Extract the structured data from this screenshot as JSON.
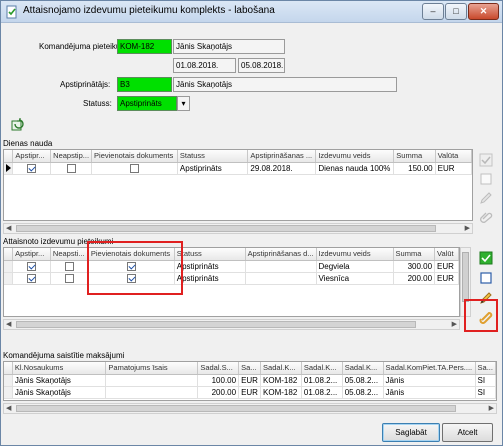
{
  "window": {
    "title": "Attaisnojamo izdevumu pieteikumu komplekts - labošana"
  },
  "form": {
    "komandejuma_label": "Komandējuma pieteikums:",
    "komandejuma_code": "KOM-182",
    "komandejuma_name": "Jānis Skaņotājs",
    "date_from": "01.08.2018.",
    "date_to": "05.08.2018.",
    "apstiprinatajs_label": "Apstiprinātājs:",
    "apstiprinatajs_code": "B3",
    "apstiprinatajs_name": "Jānis Skaņotājs",
    "statuss_label": "Statuss:",
    "statuss_value": "Apstiprināts"
  },
  "dienas_nauda": {
    "title": "Dienas nauda",
    "columns": [
      "Apstipr...",
      "Neapstip...",
      "Pievienotais dokuments",
      "Statuss",
      "Apstiprināšanas ...",
      "Izdevumu veids",
      "Summa",
      "Valūta"
    ],
    "rows": [
      {
        "apstiprinats": true,
        "neapstiprinats": false,
        "pievienots": false,
        "statuss": "Apstiprināts",
        "datums": "29.08.2018.",
        "veids": "Dienas nauda 100%",
        "summa": "150.00",
        "valuta": "EUR"
      }
    ]
  },
  "izdevumi": {
    "title": "Attaisnoto izdevumu pieteikumi",
    "columns": [
      "Apstipr...",
      "Neapsti...",
      "Pievienotais dokuments",
      "Statuss",
      "Apstiprināšanas d...",
      "Izdevumu veids",
      "Summa",
      "Valūt"
    ],
    "rows": [
      {
        "apstiprinats": true,
        "neapstiprinats": false,
        "pievienots": true,
        "statuss": "Apstiprināts",
        "datums": "",
        "veids": "Degviela",
        "summa": "300.00",
        "valuta": "EUR"
      },
      {
        "apstiprinats": true,
        "neapstiprinats": false,
        "pievienots": true,
        "statuss": "Apstiprināts",
        "datums": "",
        "veids": "Viesnīca",
        "summa": "200.00",
        "valuta": "EUR"
      }
    ]
  },
  "maksajumi": {
    "title": "Komandējuma saistītie maksājumi",
    "columns": [
      "Kl.Nosaukums",
      "Pamatojums īsais",
      "Sadal.S...",
      "Sa...",
      "Sadal.K...",
      "Sadal.K...",
      "Sadal.K...",
      "Sadal.KomPiet.TA.Pers....",
      "Sa..."
    ],
    "rows": [
      {
        "nosaukums": "Jānis Skaņotājs",
        "pamatojums": "",
        "summa": "100.00",
        "valuta": "EUR",
        "kom": "KOM-182",
        "no": "01.08.2...",
        "lidz": "05.08.2...",
        "pers": "Jānis",
        "sa": "SI"
      },
      {
        "nosaukums": "Jānis Skaņotājs",
        "pamatojums": "",
        "summa": "200.00",
        "valuta": "EUR",
        "kom": "KOM-182",
        "no": "01.08.2...",
        "lidz": "05.08.2...",
        "pers": "Jānis",
        "sa": "SI"
      }
    ]
  },
  "buttons": {
    "save": "Saglabāt",
    "cancel": "Atcelt"
  },
  "colors": {
    "highlight_green": "#00e000",
    "annotation_red": "#e02020"
  },
  "icons": {
    "app": "document-check-icon",
    "refresh": "refresh-icon",
    "confirm": "green-check-icon",
    "uncheck": "empty-checkbox-icon",
    "edit": "pencil-icon",
    "attach": "paperclip-icon"
  }
}
